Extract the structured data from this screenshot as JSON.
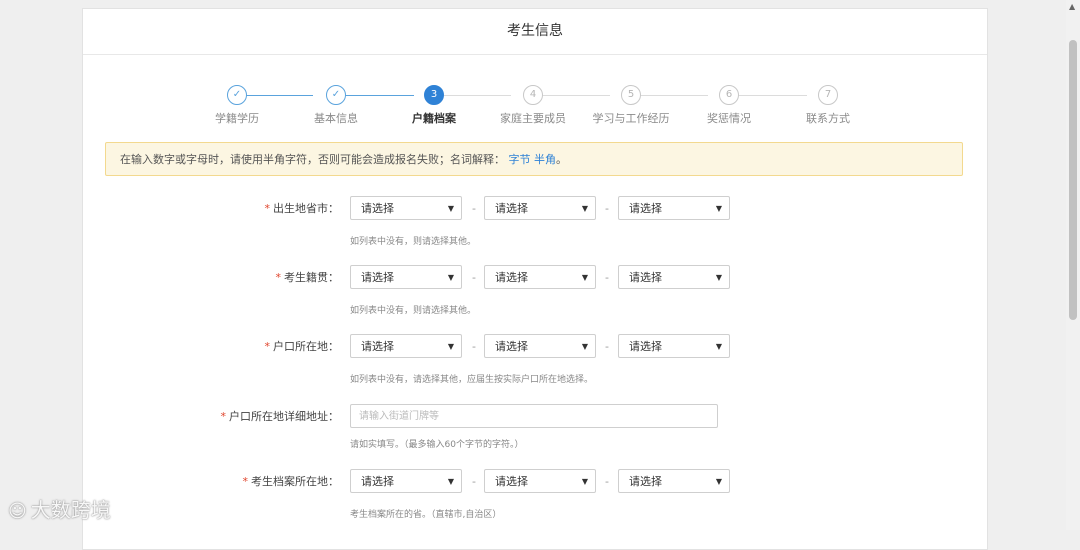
{
  "page": {
    "title": "考生信息"
  },
  "steps": [
    {
      "number": "✓",
      "label": "学籍学历",
      "state": "done"
    },
    {
      "number": "✓",
      "label": "基本信息",
      "state": "done"
    },
    {
      "number": "3",
      "label": "户籍档案",
      "state": "active"
    },
    {
      "number": "4",
      "label": "家庭主要成员",
      "state": "todo"
    },
    {
      "number": "5",
      "label": "学习与工作经历",
      "state": "todo"
    },
    {
      "number": "6",
      "label": "奖惩情况",
      "state": "todo"
    },
    {
      "number": "7",
      "label": "联系方式",
      "state": "todo"
    }
  ],
  "notice": {
    "text": "在输入数字或字母时，请使用半角字符，否则可能会造成报名失败；名词解释：",
    "link1": "字节",
    "link2": "半角",
    "end": "。"
  },
  "required_mark": "*",
  "dash": "-",
  "select_placeholder": "请选择",
  "select_arrow": "▼",
  "form": {
    "birthplace": {
      "label": "出生地省市：",
      "hint": "如列表中没有，则请选择其他。"
    },
    "native_place": {
      "label": "考生籍贯：",
      "hint": "如列表中没有，则请选择其他。"
    },
    "hukou_location": {
      "label": "户口所在地：",
      "hint": "如列表中没有，请选择其他，应届生按实际户口所在地选择。"
    },
    "hukou_address": {
      "label": "户口所在地详细地址：",
      "placeholder": "请输入街道门牌等",
      "hint": "请如实填写。（最多输入60个字节的字符。）"
    },
    "archive_location": {
      "label": "考生档案所在地：",
      "hint": "考生档案所在的省。（直辖市,自治区）"
    }
  },
  "watermark": {
    "icon": "☺",
    "text": "大数跨境"
  },
  "colors": {
    "accent": "#2f82d6",
    "required": "#e0442c",
    "notice_bg": "#fcf6e2"
  }
}
